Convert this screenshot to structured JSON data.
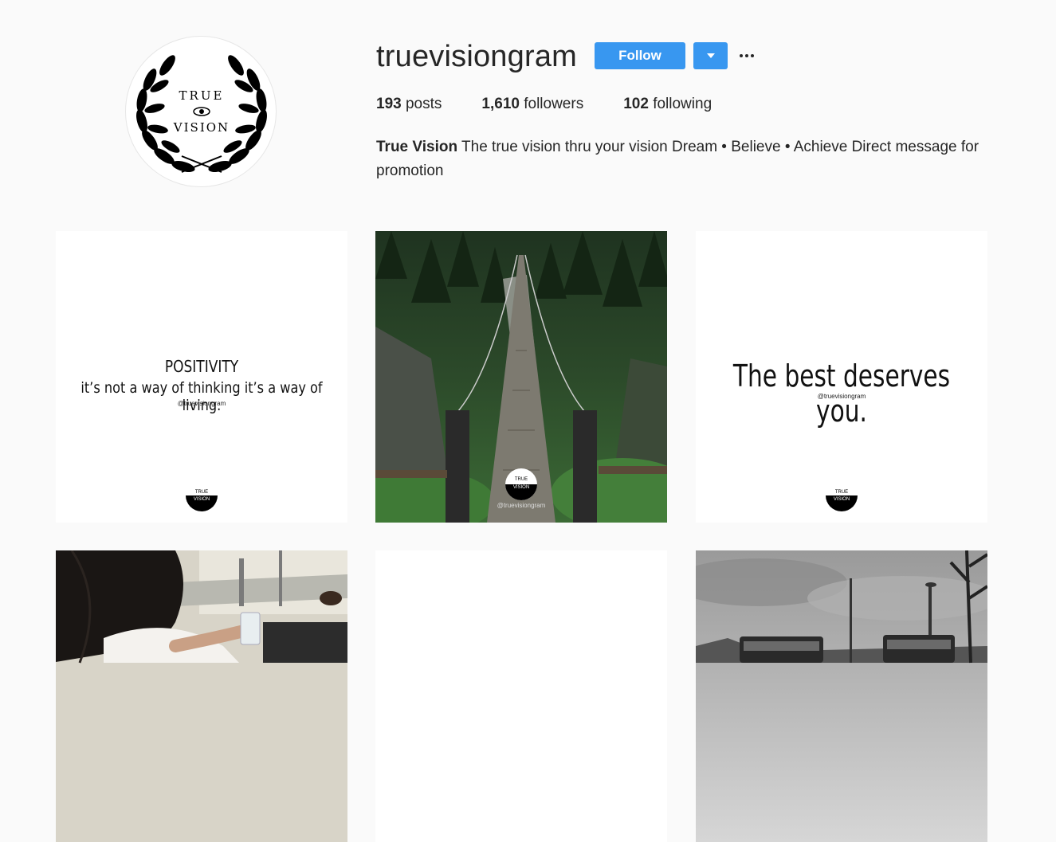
{
  "profile": {
    "username": "truevisiongram",
    "follow_label": "Follow",
    "avatar_text_top": "TRUE",
    "avatar_text_bottom": "VISION"
  },
  "stats": [
    {
      "count": "193",
      "label": "posts"
    },
    {
      "count": "1,610",
      "label": "followers"
    },
    {
      "count": "102",
      "label": "following"
    }
  ],
  "bio": {
    "name": "True Vision",
    "text": "The true vision thru your vision Dream • Believe • Achieve Direct message for promotion"
  },
  "posts": [
    {
      "type": "quote",
      "heading": "POSITIVITY",
      "line": "it’s not a way of thinking it’s a way of living.",
      "handle": "@truevisiongram",
      "logo_top": "TRUE",
      "logo_bottom": "VISION"
    },
    {
      "type": "photo",
      "subject": "suspension bridge in forest",
      "handle": "@truevisiongram",
      "logo_top": "TRUE",
      "logo_bottom": "VISION"
    },
    {
      "type": "quote",
      "line": "The best deserves you.",
      "handle": "@truevisiongram",
      "logo_top": "TRUE",
      "logo_bottom": "VISION"
    },
    {
      "type": "photo",
      "subject": "woman on a boat"
    },
    {
      "type": "blank"
    },
    {
      "type": "photo",
      "subject": "black and white cars"
    }
  ]
}
